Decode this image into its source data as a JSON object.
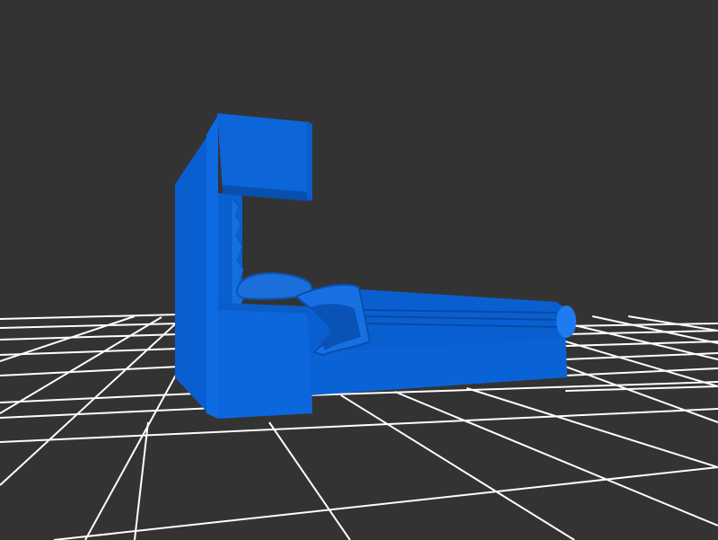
{
  "viewer": {
    "background": "#333333",
    "grid_color": "#ffffff",
    "model_color": "#0a63d6",
    "model_shadow_color": "#0748a6",
    "model_highlight_color": "#1f7ef0",
    "object": "bed-with-headboard-shelf"
  }
}
